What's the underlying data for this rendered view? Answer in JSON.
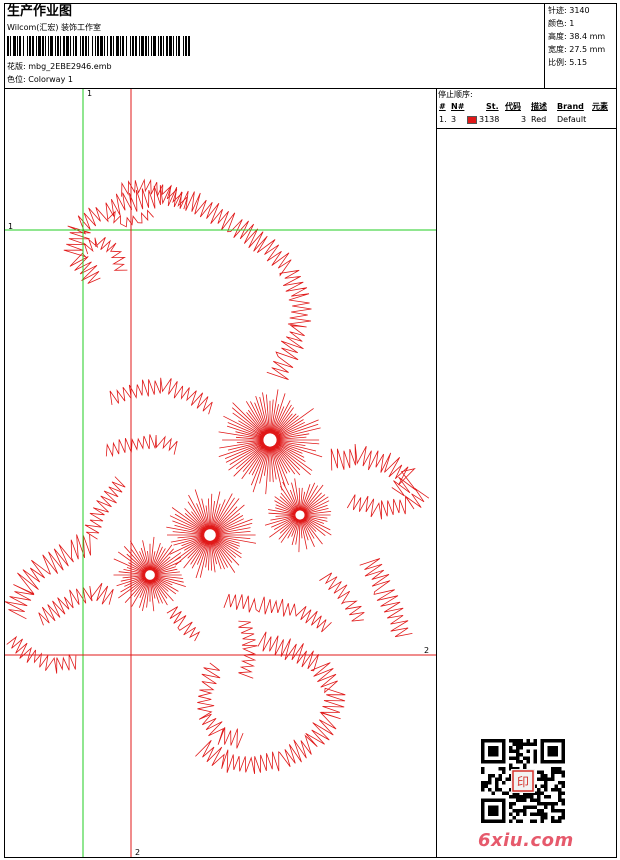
{
  "header": {
    "title": "生产作业图",
    "company": "Wilcom(汇宏) 装饰工作室",
    "design_label": "花版: mbg_2EBE2946.emb",
    "colorway_label": "色位: Colorway 1"
  },
  "stats": {
    "stitches": "针迹: 3140",
    "colors": "颜色: 1",
    "height": "高度: 38.4 mm",
    "width": "宽度: 27.5 mm",
    "scale": "比例: 5.15"
  },
  "stop_sequence": {
    "title": "停止顺序:",
    "headers": [
      "#",
      "N#",
      "St.",
      "代码",
      "描述",
      "Brand",
      "元素"
    ],
    "rows": [
      {
        "num": "1.",
        "needle": "3",
        "stitches": "3138",
        "code": "3",
        "desc": "Red",
        "brand": "Default",
        "color": "#e01818"
      }
    ]
  },
  "guides": {
    "v1_label": "1",
    "h1_label": "1",
    "h2_label": "2",
    "v2_label": "2"
  },
  "watermark": {
    "text": "6xiu.com",
    "seal_text": "印"
  },
  "colors": {
    "stitch": "#e01818",
    "guide_green": "#22cc22",
    "guide_red": "#e01818",
    "border": "#000000"
  }
}
